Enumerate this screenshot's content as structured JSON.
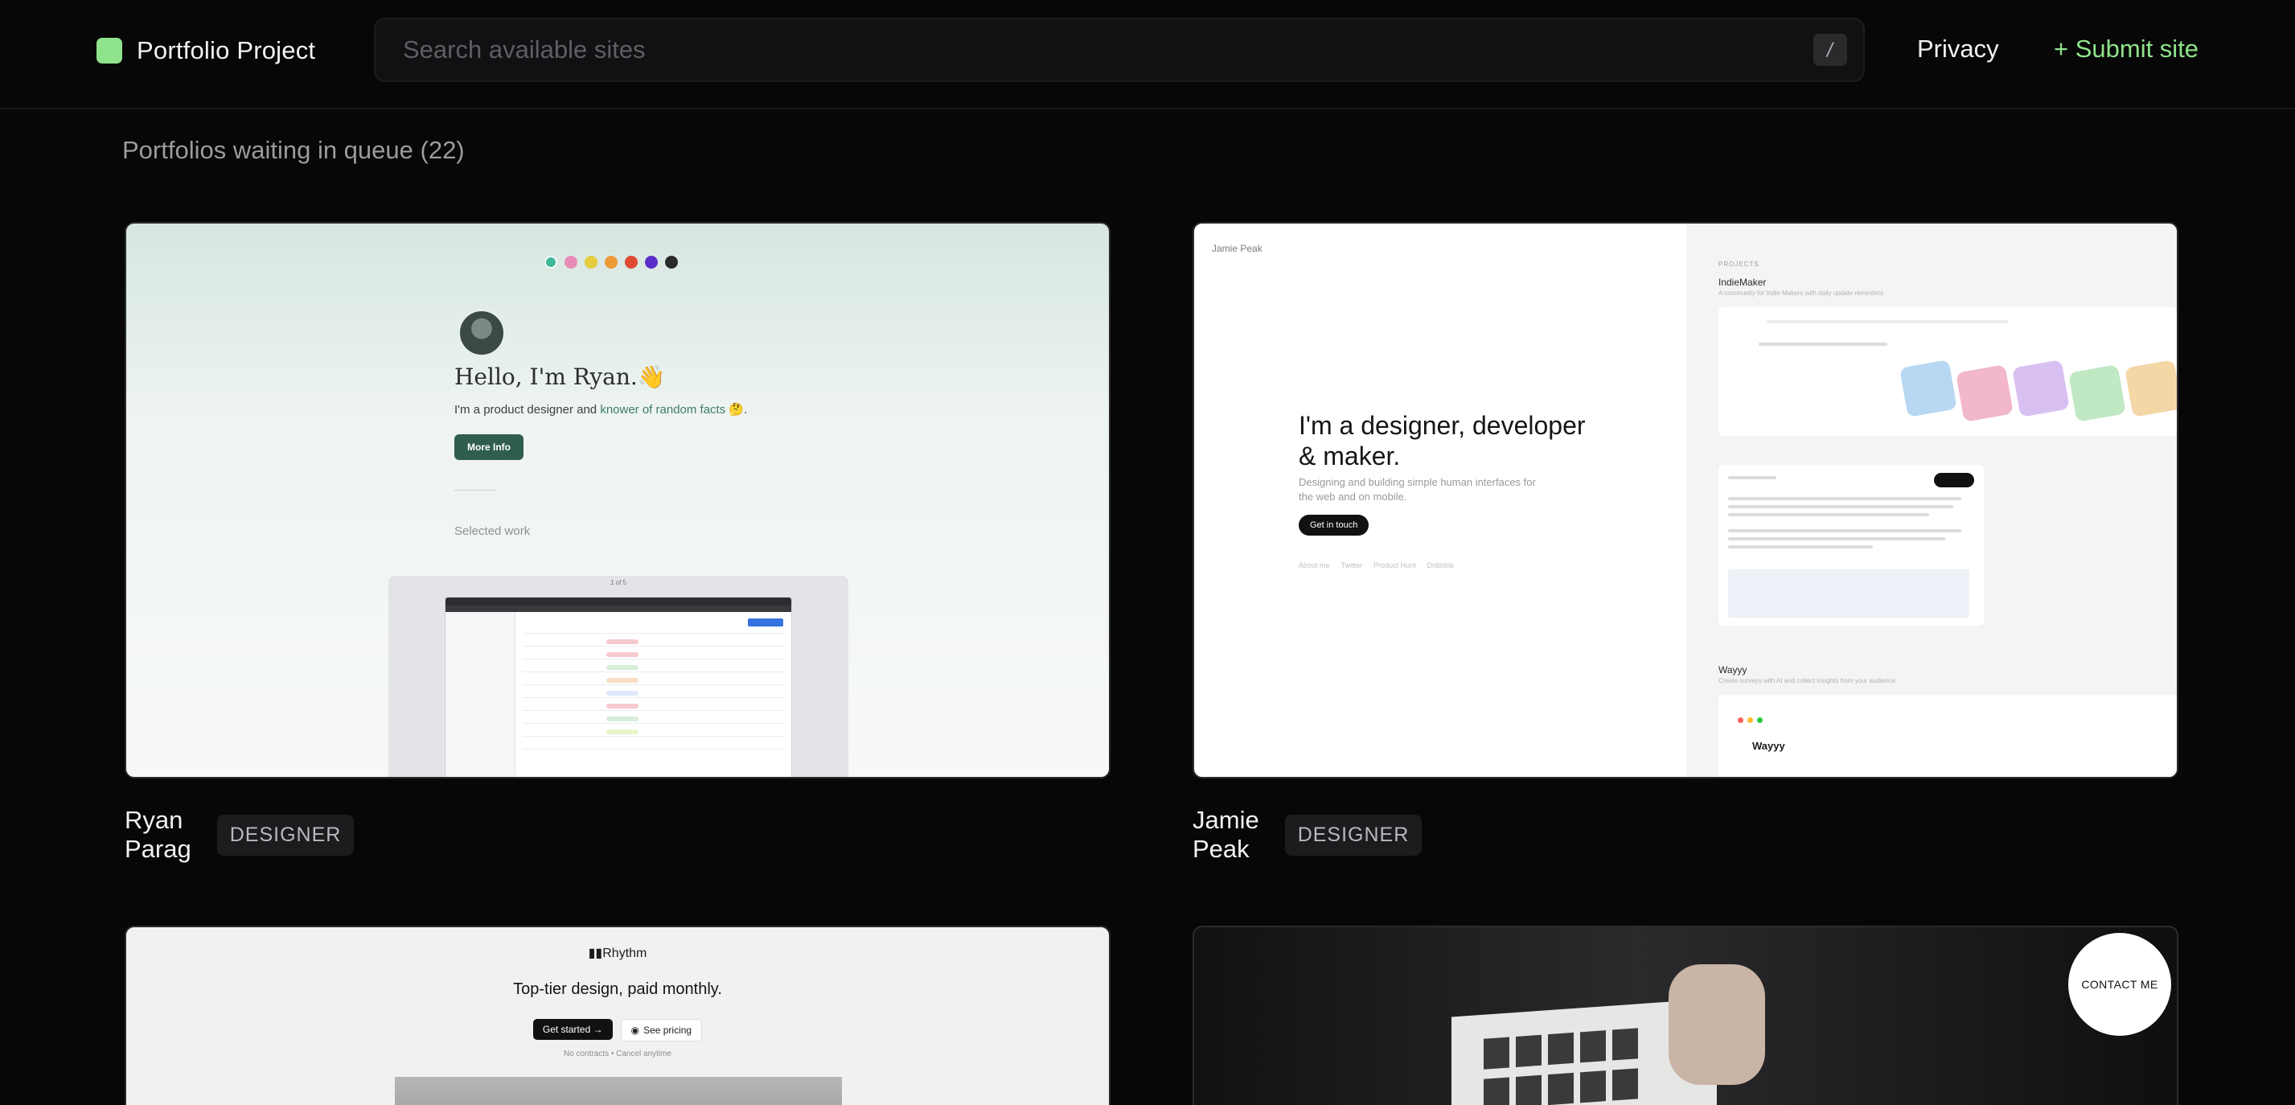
{
  "brand": {
    "name": "Portfolio Project",
    "color": "#8fe38a"
  },
  "search": {
    "placeholder": "Search available sites",
    "shortcut": "/"
  },
  "nav": {
    "privacy": "Privacy",
    "submit": "+ Submit site"
  },
  "queue": {
    "title": "Portfolios waiting in queue (22)"
  },
  "cards": [
    {
      "name": "Ryan Parag",
      "role": "DESIGNER",
      "preview": {
        "greeting": "Hello, I'm Ryan.",
        "wave": "👋",
        "intro": "I'm a product designer and",
        "intro_link": "knower of random facts",
        "intro_emoji": "🤔",
        "intro_end": ".",
        "button": "More Info",
        "section": "Selected work",
        "frame_label": "1 of 5"
      }
    },
    {
      "name": "Jamie Peak",
      "role": "DESIGNER",
      "preview": {
        "site_name": "Jamie Peak",
        "headline": "I'm a designer, developer & maker.",
        "subline": "Designing and building simple human interfaces for the web and on mobile.",
        "button": "Get in touch",
        "links": [
          "About me",
          "Twitter",
          "Product Hunt",
          "Dribbble"
        ],
        "projects_label": "PROJECTS",
        "project_1": "IndieMaker",
        "project_1_desc": "A community for Indie Makers with daily update reminders",
        "project_2": "Wayyy",
        "project_2_desc": "Create surveys with AI and collect insights from your audience",
        "wayyy_logo": "Wayyy"
      }
    },
    {
      "name": "",
      "role": "",
      "preview": {
        "logo": "Rhythm",
        "headline": "Top-tier design, paid monthly.",
        "button_primary": "Get started →",
        "button_secondary": "See pricing",
        "note": "No contracts • Cancel anytime"
      }
    },
    {
      "name": "",
      "role": "",
      "preview": {
        "contact": "CONTACT ME"
      }
    }
  ]
}
